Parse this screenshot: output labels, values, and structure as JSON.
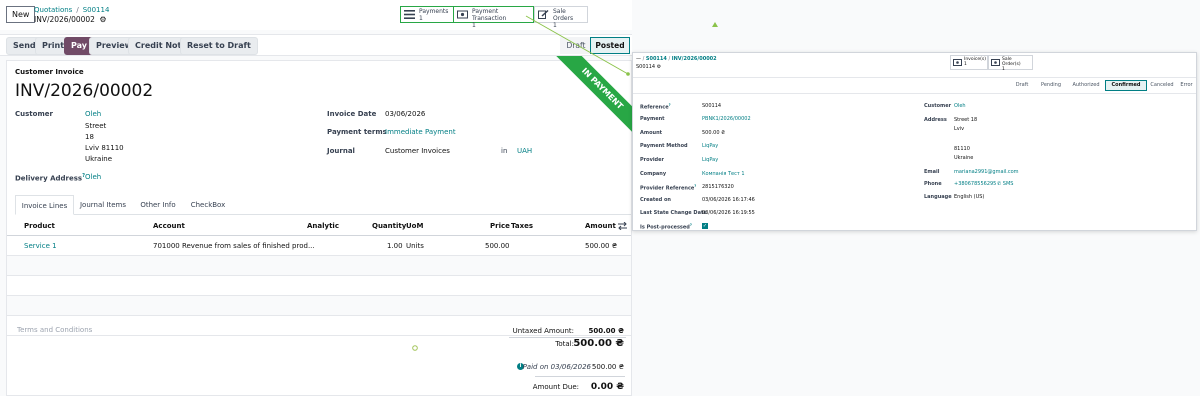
{
  "header": {
    "new_label": "New",
    "breadcrumb_root": "Quotations",
    "breadcrumb_order": "S00114",
    "breadcrumb_current": "INV/2026/00002",
    "gear": "⚙"
  },
  "smart_buttons": [
    {
      "label": "Payments",
      "count": "1",
      "icon": "list-icon"
    },
    {
      "label": "Payment Transaction",
      "count": "1",
      "icon": "money-icon"
    },
    {
      "label": "Sale Orders",
      "count": "1",
      "icon": "edit-icon"
    }
  ],
  "actions": {
    "send": "Send",
    "print": "Print",
    "pay": "Pay",
    "preview": "Preview",
    "credit_note": "Credit Note",
    "reset": "Reset to Draft"
  },
  "status": {
    "draft": "Draft",
    "posted": "Posted"
  },
  "ribbon": "IN PAYMENT",
  "invoice": {
    "type_label": "Customer Invoice",
    "number": "INV/2026/00002",
    "customer_label": "Customer",
    "customer_name": "Oleh",
    "address_1": "Street",
    "address_2": "18",
    "address_3": "Lviv 81110",
    "address_4": "Ukraine",
    "delivery_label": "Delivery Address",
    "delivery_help": "?",
    "delivery_value": "Oleh",
    "date_label": "Invoice Date",
    "date_value": "03/06/2026",
    "terms_label": "Payment terms",
    "terms_value": "Immediate Payment",
    "journal_label": "Journal",
    "journal_value": "Customer Invoices",
    "journal_in": "in",
    "currency": "UAH"
  },
  "tabs": [
    "Invoice Lines",
    "Journal Items",
    "Other Info",
    "CheckBox"
  ],
  "lines": {
    "headers": [
      "Product",
      "Account",
      "Analytic",
      "Quantity",
      "UoM",
      "Price",
      "Taxes",
      "Amount"
    ],
    "rows": [
      {
        "product": "Service 1",
        "account": "701000 Revenue from sales of finished prod...",
        "quantity": "1.00",
        "uom": "Units",
        "price": "500.00",
        "amount": "500.00 ₴"
      }
    ]
  },
  "terms_placeholder": "Terms and Conditions",
  "totals": {
    "untaxed_label": "Untaxed Amount:",
    "untaxed_value": "500.00 ₴",
    "total_label": "Total:",
    "total_value": "500.00 ₴",
    "paid_label": "Paid on 03/06/2026",
    "paid_value": "500.00 ₴",
    "due_label": "Amount Due:",
    "due_value": "0.00 ₴"
  },
  "popover": {
    "bc_root": "S00114",
    "bc_current": "INV/2026/00002",
    "title": "S00114",
    "smart": [
      {
        "label": "Invoice(s)",
        "count": "1"
      },
      {
        "label": "Sale Order(s)",
        "count": "1"
      }
    ],
    "stages": [
      "Draft",
      "Pending",
      "Authorized",
      "Confirmed",
      "Canceled",
      "Error"
    ],
    "active_stage": "Confirmed",
    "left_fields": [
      {
        "label": "Reference",
        "help": "?",
        "value": "S00114",
        "link": false
      },
      {
        "label": "Payment",
        "help": "",
        "value": "PBNK1/2026/00002",
        "link": true
      },
      {
        "label": "Amount",
        "help": "",
        "value": "500.00 ₴",
        "link": false
      },
      {
        "label": "Payment Method",
        "help": "",
        "value": "LiqPay",
        "link": true
      },
      {
        "label": "Provider",
        "help": "",
        "value": "LiqPay",
        "link": true
      },
      {
        "label": "Company",
        "help": "",
        "value": "Компанія Тест 1",
        "link": true
      },
      {
        "label": "Provider Reference",
        "help": "?",
        "value": "2815176320",
        "link": false
      },
      {
        "label": "Created on",
        "help": "",
        "value": "03/06/2026 16:17:46",
        "link": false
      },
      {
        "label": "Last State Change Date",
        "help": "",
        "value": "03/06/2026 16:19:55",
        "link": false
      },
      {
        "label": "Is Post-processed",
        "help": "?",
        "value": "",
        "link": false
      }
    ],
    "customer_label": "Customer",
    "customer_value": "Oleh",
    "address_label": "Address",
    "address_1": "Street 18",
    "address_2": "Lviv",
    "address_3": "81110",
    "address_4": "Ukraine",
    "email_label": "Email",
    "email_value": "mariana2991@gmail.com",
    "phone_label": "Phone",
    "phone_value": "+380678556295",
    "sms_label": "SMS",
    "language_label": "Language",
    "language_value": "English (US)"
  },
  "colors": {
    "brand": "#714b67",
    "link": "#017e84",
    "ribbon": "#28a745",
    "check": "#017e84"
  }
}
